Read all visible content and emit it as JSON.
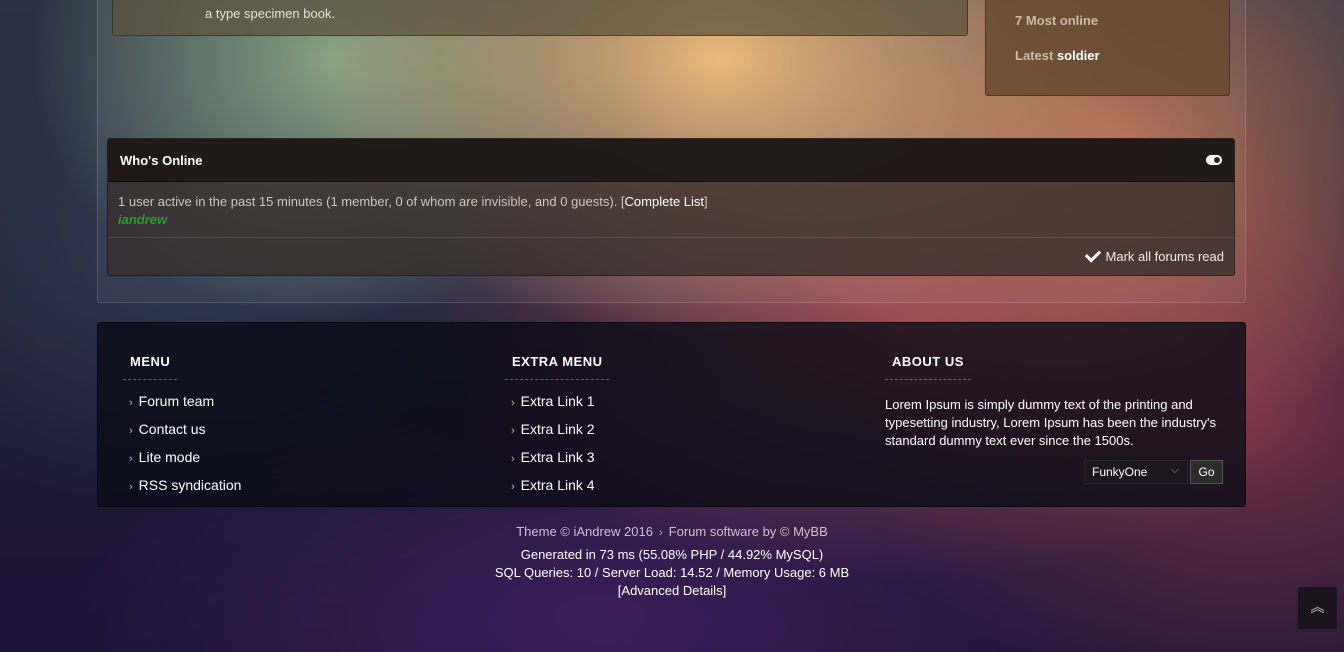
{
  "post": {
    "snippet": "a type specimen book."
  },
  "stats": {
    "most_online": "7 Most online",
    "latest_prefix": "Latest",
    "latest_user": "soldier"
  },
  "whos_online": {
    "title": "Who's Online",
    "summary_prefix": "1 user active in the past 15 minutes (1 member, 0 of whom are invisible, and 0 guests). [",
    "complete_list": "Complete List",
    "summary_suffix": "]",
    "member": "iandrew",
    "mark_read": "Mark all forums read"
  },
  "footer": {
    "menu": {
      "title": "MENU",
      "items": [
        "Forum team",
        "Contact us",
        "Lite mode",
        "RSS syndication"
      ]
    },
    "extra_menu": {
      "title": "EXTRA MENU",
      "items": [
        "Extra Link 1",
        "Extra Link 2",
        "Extra Link 3",
        "Extra Link 4"
      ]
    },
    "about": {
      "title": "ABOUT US",
      "text": "Lorem Ipsum is simply dummy text of the printing and typesetting industry, Lorem Ipsum has been the industry's standard dummy text ever since the 1500s."
    },
    "theme_select": {
      "selected": "FunkyOne"
    },
    "go_label": "Go"
  },
  "copyright": {
    "theme": "Theme © iAndrew 2016",
    "software": "Forum software by © MyBB",
    "generated": "Generated in 73 ms (55.08% PHP / 44.92% MySQL)",
    "queries": "SQL Queries: 10 / Server Load: 14.52 / Memory Usage: 6 MB",
    "advanced_open": "[",
    "advanced": "Advanced Details",
    "advanced_close": "]"
  },
  "icons": {
    "toggle": "toggle-icon",
    "check": "check-icon",
    "back_to_top": "double-chevron-up-icon"
  }
}
